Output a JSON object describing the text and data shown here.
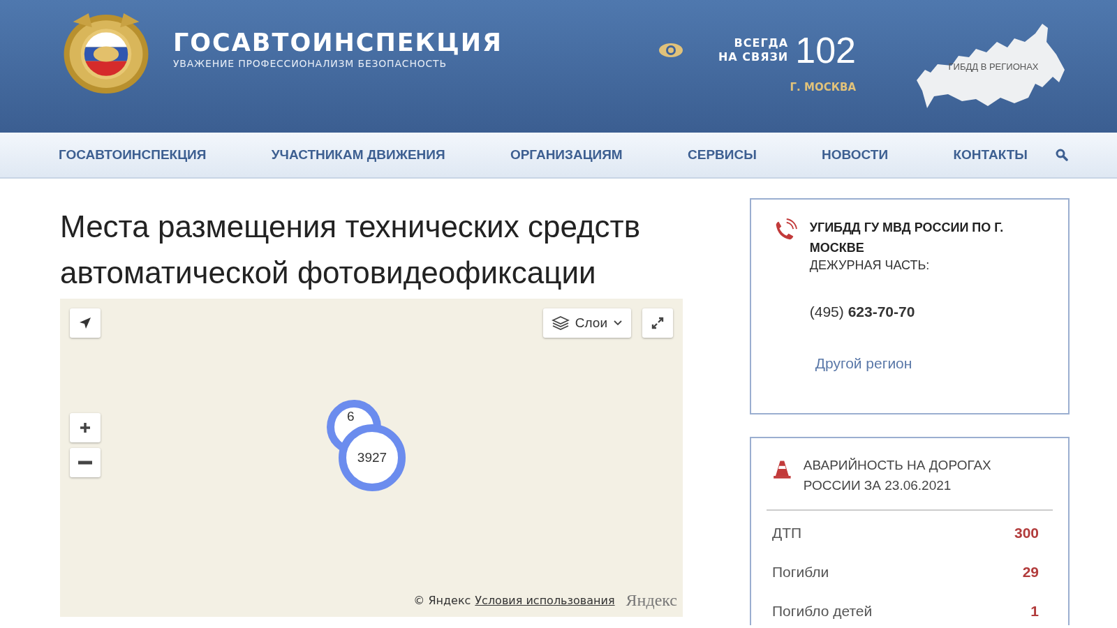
{
  "header": {
    "title": "ГОСАВТОИНСПЕКЦИЯ",
    "slogan": "УВАЖЕНИЕ ПРОФЕССИОНАЛИЗМ БЕЗОПАСНОСТЬ",
    "hotline_caption": [
      "ВСЕГДА",
      "НА СВЯЗИ"
    ],
    "hotline_number": "102",
    "city": "Г. МОСКВА",
    "regions_link": "ГИБДД В РЕГИОНАХ"
  },
  "nav": {
    "items": [
      {
        "label": "ГОСАВТОИНСПЕКЦИЯ"
      },
      {
        "label": "УЧАСТНИКАМ ДВИЖЕНИЯ"
      },
      {
        "label": "ОРГАНИЗАЦИЯМ"
      },
      {
        "label": "СЕРВИСЫ"
      },
      {
        "label": "НОВОСТИ"
      },
      {
        "label": "КОНТАКТЫ"
      }
    ]
  },
  "page_title": "Места размещения технических средств автоматической фотовидеофиксации",
  "map": {
    "layers_button": "Слои",
    "clusters": [
      {
        "count": "6"
      },
      {
        "count": "3927"
      }
    ],
    "copyright": "© Яндекс",
    "terms_link": "Условия использования",
    "logo": "Яндекс"
  },
  "contact_card": {
    "org": "УГИБДД ГУ МВД РОССИИ ПО Г. МОСКВЕ",
    "caption": "ДЕЖУРНАЯ ЧАСТЬ:",
    "phone": "(495) **623-70-70**",
    "other_region": "Другой регион"
  },
  "accidents": {
    "title": "АВАРИЙНОСТЬ НА ДОРОГАХ РОССИИ ЗА 23.06.2021",
    "rows": [
      {
        "label": "ДТП",
        "value": "300"
      },
      {
        "label": "Погибли",
        "value": "29"
      },
      {
        "label": "Погибло детей",
        "value": "1"
      }
    ]
  }
}
